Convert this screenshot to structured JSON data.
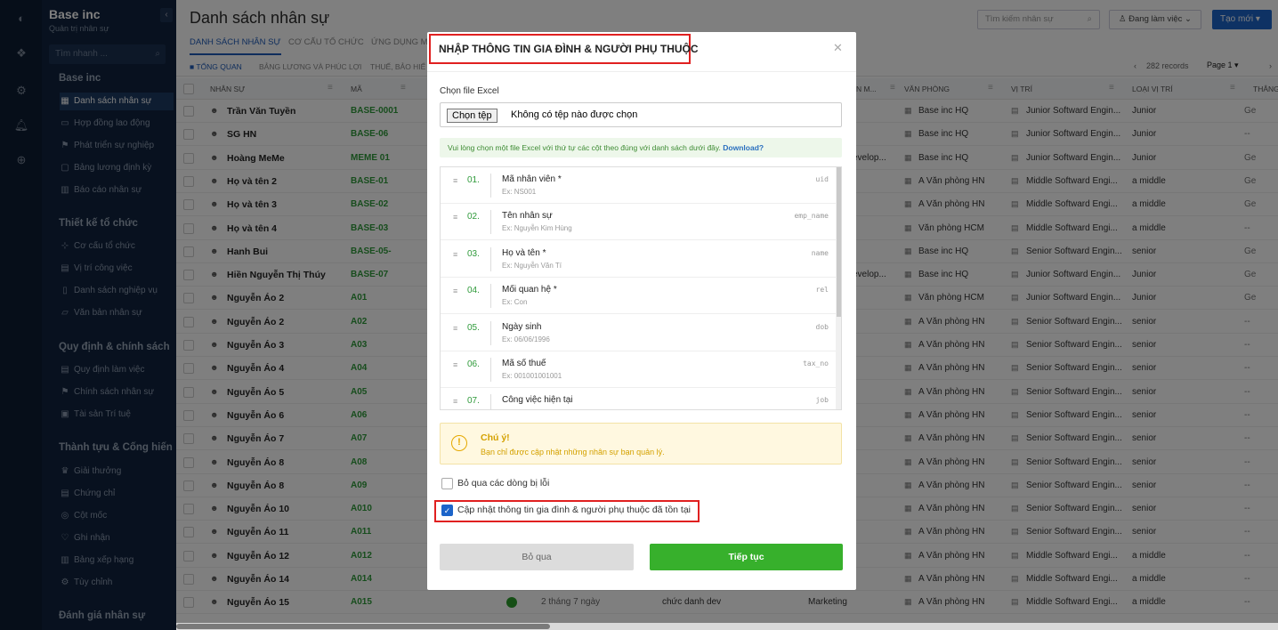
{
  "sidebar": {
    "org_name": "Base inc",
    "org_sub": "Quản trị nhân sự",
    "search_placeholder": "Tìm nhanh ...",
    "sections": [
      {
        "title": "Base inc",
        "items": [
          {
            "label": "Danh sách nhân sự",
            "icon": "grid-icon",
            "active": true
          },
          {
            "label": "Hợp đồng lao động",
            "icon": "contract-icon"
          },
          {
            "label": "Phát triển sự nghiệp",
            "icon": "flag-icon"
          },
          {
            "label": "Bảng lương định kỳ",
            "icon": "wallet-icon"
          },
          {
            "label": "Báo cáo nhân sự",
            "icon": "chart-icon"
          }
        ]
      },
      {
        "title": "Thiết kế tổ chức",
        "items": [
          {
            "label": "Cơ cấu tổ chức",
            "icon": "org-icon"
          },
          {
            "label": "Vị trí công việc",
            "icon": "briefcase-icon"
          },
          {
            "label": "Danh sách nghiệp vụ",
            "icon": "book-icon"
          },
          {
            "label": "Văn bản nhân sự",
            "icon": "folder-icon"
          }
        ]
      },
      {
        "title": "Quy định & chính sách",
        "items": [
          {
            "label": "Quy định làm việc",
            "icon": "rules-icon"
          },
          {
            "label": "Chính sách nhân sự",
            "icon": "flag-icon"
          },
          {
            "label": "Tài sản Trí tuệ",
            "icon": "ip-icon"
          }
        ]
      },
      {
        "title": "Thành tựu & Cống hiến",
        "items": [
          {
            "label": "Giải thưởng",
            "icon": "trophy-icon"
          },
          {
            "label": "Chứng chỉ",
            "icon": "certificate-icon"
          },
          {
            "label": "Cột mốc",
            "icon": "milestone-icon"
          },
          {
            "label": "Ghi nhận",
            "icon": "heart-icon"
          },
          {
            "label": "Bảng xếp hạng",
            "icon": "ranking-icon"
          },
          {
            "label": "Tùy chỉnh",
            "icon": "settings-icon"
          }
        ]
      },
      {
        "title": "Đánh giá nhân sự",
        "items": []
      }
    ]
  },
  "main": {
    "title": "Danh sách nhân sự",
    "tabs": [
      "DANH SÁCH NHÂN SỰ",
      "CƠ CẤU TỔ CHỨC",
      "ỨNG DỤNG MỞ"
    ],
    "search_placeholder": "Tìm kiếm nhân sự",
    "status_filter": "Đang làm việc",
    "create_label": "Tạo mới",
    "subtabs": [
      "TỔNG QUAN",
      "BẢNG LƯƠNG VÀ PHÚC LỢI",
      "THUẾ, BẢO HIỂ"
    ],
    "records": "282 records",
    "page": "Page 1",
    "columns": [
      "NHÂN SỰ",
      "MÃ",
      "N M...",
      "VĂN PHÒNG",
      "VỊ TRÍ",
      "LOẠI VỊ TRÍ",
      "THÂNG"
    ],
    "rows": [
      {
        "name": "Trần Văn Tuyền",
        "code": "BASE-0001",
        "office": "Base inc HQ",
        "position": "Junior Softward Engin...",
        "level": "Junior",
        "ext": "Ge"
      },
      {
        "name": "SG HN",
        "code": "BASE-06",
        "office": "Base inc HQ",
        "position": "Junior Softward Engin...",
        "level": "Junior",
        "ext": "--"
      },
      {
        "name": "Hoàng MeMe",
        "code": "MEME 01",
        "office": "Base inc HQ",
        "position": "Junior Softward Engin...",
        "level": "Junior",
        "ext": "Ge",
        "frag": "evelop..."
      },
      {
        "name": "Họ và tên 2",
        "code": "BASE-01",
        "office": "A Văn phòng HN",
        "position": "Middle Softward Engi...",
        "level": "a middle",
        "ext": "Ge"
      },
      {
        "name": "Họ và tên 3",
        "code": "BASE-02",
        "office": "A Văn phòng HN",
        "position": "Middle Softward Engi...",
        "level": "a middle",
        "ext": "Ge"
      },
      {
        "name": "Họ và tên 4",
        "code": "BASE-03",
        "office": "Văn phòng HCM",
        "position": "Middle Softward Engi...",
        "level": "a middle",
        "ext": "--"
      },
      {
        "name": "Hanh Bui",
        "code": "BASE-05-",
        "office": "Base inc HQ",
        "position": "Senior Softward Engin...",
        "level": "senior",
        "ext": "Ge"
      },
      {
        "name": "Hiền Nguyễn Thị Thúy",
        "code": "BASE-07",
        "office": "Base inc HQ",
        "position": "Junior Softward Engin...",
        "level": "Junior",
        "ext": "Ge",
        "frag": "evelop..."
      },
      {
        "name": "Nguyễn Áo 2",
        "code": "A01",
        "office": "Văn phòng HCM",
        "position": "Junior Softward Engin...",
        "level": "Junior",
        "ext": "Ge"
      },
      {
        "name": "Nguyễn Áo 2",
        "code": "A02",
        "office": "A Văn phòng HN",
        "position": "Senior Softward Engin...",
        "level": "senior",
        "ext": "--"
      },
      {
        "name": "Nguyễn Áo 3",
        "code": "A03",
        "office": "A Văn phòng HN",
        "position": "Senior Softward Engin...",
        "level": "senior",
        "ext": "--"
      },
      {
        "name": "Nguyễn Áo 4",
        "code": "A04",
        "office": "A Văn phòng HN",
        "position": "Senior Softward Engin...",
        "level": "senior",
        "ext": "--"
      },
      {
        "name": "Nguyễn Áo 5",
        "code": "A05",
        "office": "A Văn phòng HN",
        "position": "Senior Softward Engin...",
        "level": "senior",
        "ext": "--"
      },
      {
        "name": "Nguyễn Áo 6",
        "code": "A06",
        "office": "A Văn phòng HN",
        "position": "Senior Softward Engin...",
        "level": "senior",
        "ext": "--"
      },
      {
        "name": "Nguyễn Áo 7",
        "code": "A07",
        "office": "A Văn phòng HN",
        "position": "Senior Softward Engin...",
        "level": "senior",
        "ext": "--"
      },
      {
        "name": "Nguyễn Áo 8",
        "code": "A08",
        "office": "A Văn phòng HN",
        "position": "Senior Softward Engin...",
        "level": "senior",
        "ext": "--"
      },
      {
        "name": "Nguyễn Áo 8",
        "code": "A09",
        "office": "A Văn phòng HN",
        "position": "Senior Softward Engin...",
        "level": "senior",
        "ext": "--"
      },
      {
        "name": "Nguyễn Áo 10",
        "code": "A010",
        "office": "A Văn phòng HN",
        "position": "Senior Softward Engin...",
        "level": "senior",
        "ext": "--"
      },
      {
        "name": "Nguyễn Áo 11",
        "code": "A011",
        "office": "A Văn phòng HN",
        "position": "Senior Softward Engin...",
        "level": "senior",
        "ext": "--"
      },
      {
        "name": "Nguyễn Áo 12",
        "code": "A012",
        "office": "A Văn phòng HN",
        "position": "Middle Softward Engi...",
        "level": "a middle",
        "ext": "--"
      },
      {
        "name": "Nguyễn Áo 14",
        "code": "A014",
        "office": "A Văn phòng HN",
        "position": "Middle Softward Engi...",
        "level": "a middle",
        "ext": "--"
      },
      {
        "name": "Nguyễn Áo 15",
        "code": "A015",
        "office": "A Văn phòng HN",
        "position": "Middle Softward Engi...",
        "level": "a middle",
        "ext": "--",
        "duration": "2 tháng 7 ngày",
        "title": "chức danh dev",
        "dept": "Marketing"
      }
    ]
  },
  "modal": {
    "title": "NHẬP THÔNG TIN GIA ĐÌNH & NGƯỜI PHỤ THUỘC",
    "file_label": "Chọn file Excel",
    "file_button": "Chọn tệp",
    "file_status": "Không có tệp nào được chọn",
    "note": "Vui lòng chọn một file Excel với thứ tự các cột theo đúng với danh sách dưới đây.",
    "download": "Download?",
    "columns": [
      {
        "num": "01.",
        "label": "Mã nhân viên *",
        "example": "Ex: NS001",
        "key": "uid"
      },
      {
        "num": "02.",
        "label": "Tên nhân sự",
        "example": "Ex: Nguyễn Kim Hùng",
        "key": "emp_name"
      },
      {
        "num": "03.",
        "label": "Họ và tên *",
        "example": "Ex: Nguyễn Văn Tí",
        "key": "name"
      },
      {
        "num": "04.",
        "label": "Mối quan hệ *",
        "example": "Ex: Con",
        "key": "rel"
      },
      {
        "num": "05.",
        "label": "Ngày sinh",
        "example": "Ex: 06/06/1996",
        "key": "dob"
      },
      {
        "num": "06.",
        "label": "Mã số thuế",
        "example": "Ex: 001001001001",
        "key": "tax_no"
      },
      {
        "num": "07.",
        "label": "Công việc hiện tại",
        "example": "",
        "key": "job"
      }
    ],
    "warning_title": "Chú ý!",
    "warning_text": "Bạn chỉ được cập nhật những nhân sự bạn quản lý.",
    "option_skip_errors": "Bỏ qua các dòng bị lỗi",
    "option_update_existing": "Cập nhật thông tin gia đình & người phụ thuộc đã tồn tại",
    "option_skip_checked": false,
    "option_update_checked": true,
    "cancel_label": "Bỏ qua",
    "continue_label": "Tiếp tục"
  }
}
